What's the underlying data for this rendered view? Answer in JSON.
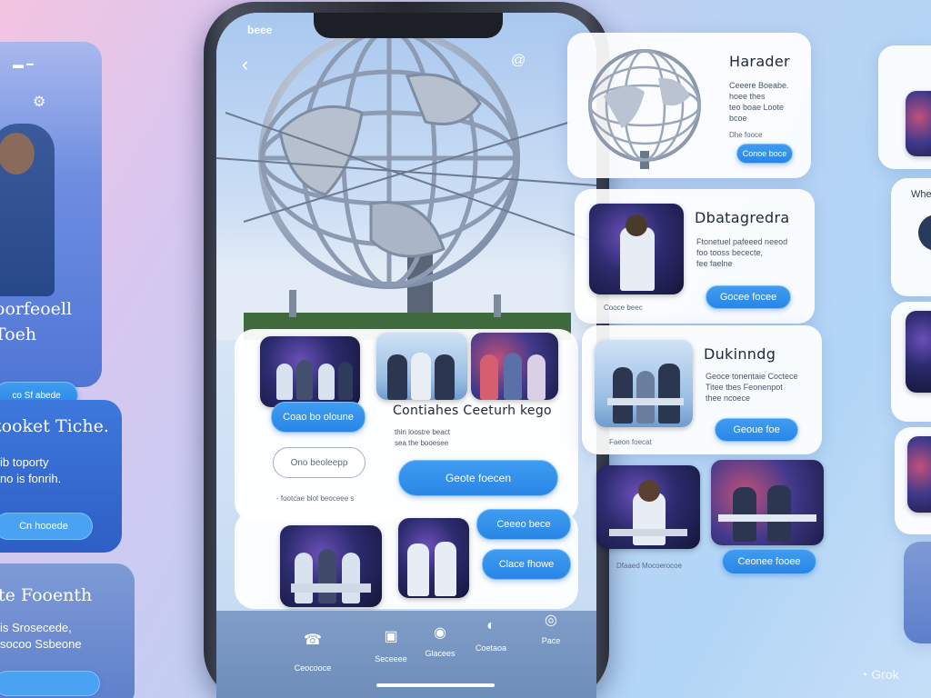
{
  "left_panel": {
    "top_card": {
      "title": "oorfeoell\nToeh",
      "button": "co Sf abede"
    },
    "mid_card": {
      "title": "tooket Tiche.",
      "body": "ib toporty\nno is fonrih.",
      "button": "Cn hooede"
    },
    "bottom_card": {
      "title": "te Fooenth",
      "body": "is Srosecede,\nsocoo Ssbeone",
      "button": ""
    }
  },
  "phone": {
    "status_left": "beee",
    "status_right": "▥ ◉ ▮",
    "back_icon": "chevron-left-icon",
    "hero_button": "Coao bo oloune",
    "content_title": "Contiahes Ceeturh kego",
    "content_sub": "thin loostre beact\nsea the booesee",
    "outline_button": "Ono beoleepp",
    "primary_button": "Geote foecen",
    "tagline": "- footcae blot beoceee s",
    "side_button_1": "Ceeeo bece",
    "side_button_2": "Clace fhowe",
    "nav": [
      {
        "icon": "☎",
        "label": "Ceocooce"
      },
      {
        "icon": "▣",
        "label": "Seceeee"
      },
      {
        "icon": "◉",
        "label": "Glacees"
      },
      {
        "icon": "◐",
        "label": "Coetaoa"
      },
      {
        "icon": "◎",
        "label": "Pace"
      }
    ]
  },
  "cards": [
    {
      "title": "Harader",
      "body": "Ceeere Boeabe.\nhoee thes\nteo boae Loote\nbcoe",
      "link": "Dhe fooce",
      "button": "Conoe boce"
    },
    {
      "title": "Dbatagredra",
      "body": "Ftonetuel pafeeed neeod\nfoo tooss bececte,\nfee faelne",
      "link": "Cooce beec",
      "button": "Gocee focee"
    },
    {
      "title": "Dukinndg",
      "body": "Geoce tonentaie Coctece\nTitee tbes Feonenpot\nthee ncoece",
      "link": "Faeon foecat",
      "button": "Geoue foe"
    }
  ],
  "bottom_strip": {
    "link": "Dfaaed Mocoerocoe",
    "button": "Ceonee fooee"
  },
  "watermark": "Grok"
}
